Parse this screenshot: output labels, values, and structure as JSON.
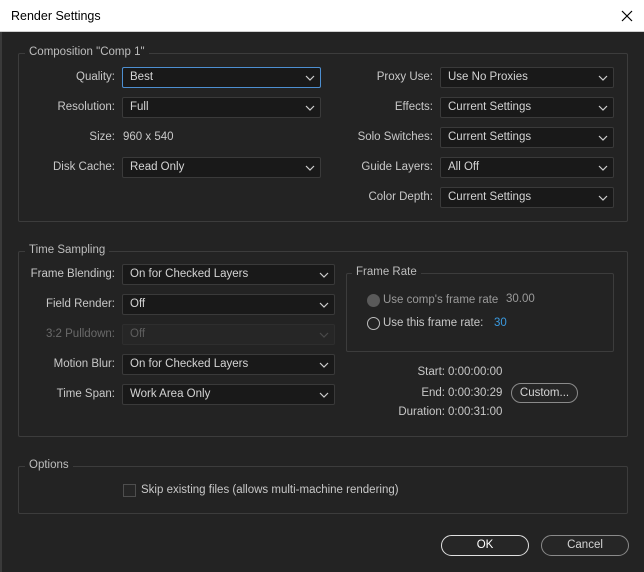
{
  "window": {
    "title": "Render Settings"
  },
  "composition": {
    "legend": "Composition \"Comp 1\"",
    "quality": {
      "label": "Quality:",
      "value": "Best"
    },
    "resolution": {
      "label": "Resolution:",
      "value": "Full"
    },
    "size": {
      "label": "Size:",
      "value": "960 x 540"
    },
    "disk_cache": {
      "label": "Disk Cache:",
      "value": "Read Only"
    },
    "proxy_use": {
      "label": "Proxy Use:",
      "value": "Use No Proxies"
    },
    "effects": {
      "label": "Effects:",
      "value": "Current Settings"
    },
    "solo_switches": {
      "label": "Solo Switches:",
      "value": "Current Settings"
    },
    "guide_layers": {
      "label": "Guide Layers:",
      "value": "All Off"
    },
    "color_depth": {
      "label": "Color Depth:",
      "value": "Current Settings"
    }
  },
  "time_sampling": {
    "legend": "Time Sampling",
    "frame_blending": {
      "label": "Frame Blending:",
      "value": "On for Checked Layers"
    },
    "field_render": {
      "label": "Field Render:",
      "value": "Off"
    },
    "pulldown": {
      "label": "3:2 Pulldown:",
      "value": "Off"
    },
    "motion_blur": {
      "label": "Motion Blur:",
      "value": "On for Checked Layers"
    },
    "time_span": {
      "label": "Time Span:",
      "value": "Work Area Only"
    },
    "frame_rate": {
      "legend": "Frame Rate",
      "use_comp_label": "Use comp's frame rate",
      "use_comp_value": "30.00",
      "use_this_label": "Use this frame rate:",
      "use_this_value": "30"
    },
    "start": {
      "label": "Start:",
      "value": "0:00:00:00"
    },
    "end": {
      "label": "End:",
      "value": "0:00:30:29"
    },
    "duration": {
      "label": "Duration:",
      "value": "0:00:31:00"
    },
    "custom_button": "Custom..."
  },
  "options": {
    "legend": "Options",
    "skip_existing": "Skip existing files (allows multi-machine rendering)"
  },
  "buttons": {
    "ok": "OK",
    "cancel": "Cancel"
  },
  "colors": {
    "background": "#232323",
    "focus_border": "#4d8fd1",
    "frame_rate_value": "#3a9ae0"
  }
}
